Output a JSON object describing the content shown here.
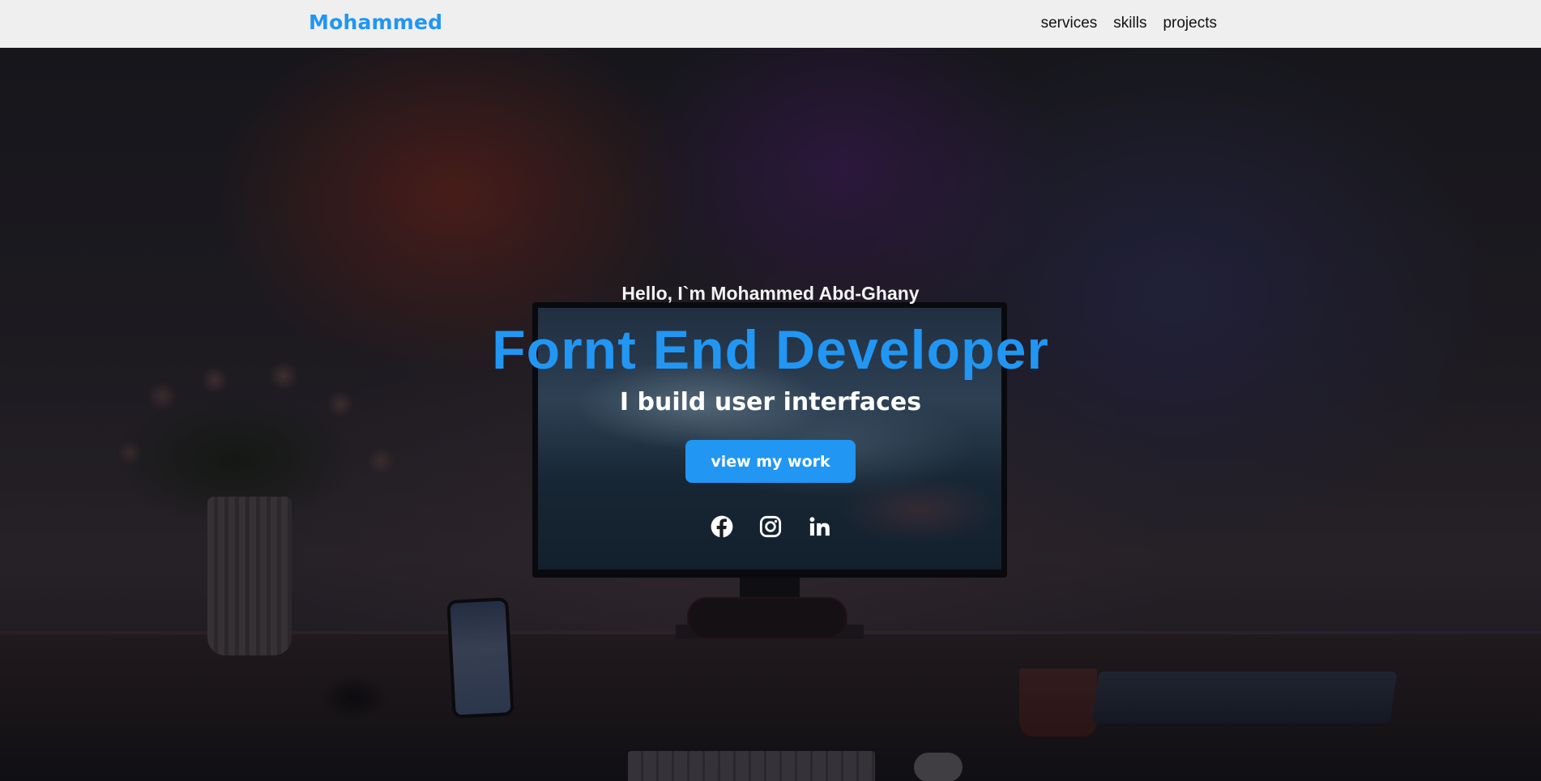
{
  "header": {
    "brand": "Mohammed",
    "nav": [
      {
        "label": "services"
      },
      {
        "label": "skills"
      },
      {
        "label": "projects"
      }
    ]
  },
  "hero": {
    "greeting": "Hello, I`m Mohammed Abd-Ghany",
    "title": "Fornt End Developer",
    "subtitle": "I build user interfaces",
    "cta_label": "view my work",
    "socials": [
      {
        "icon": "facebook-icon"
      },
      {
        "icon": "instagram-icon"
      },
      {
        "icon": "linkedin-icon"
      }
    ]
  },
  "colors": {
    "accent": "#2196f3",
    "header_bg": "#efefef"
  }
}
